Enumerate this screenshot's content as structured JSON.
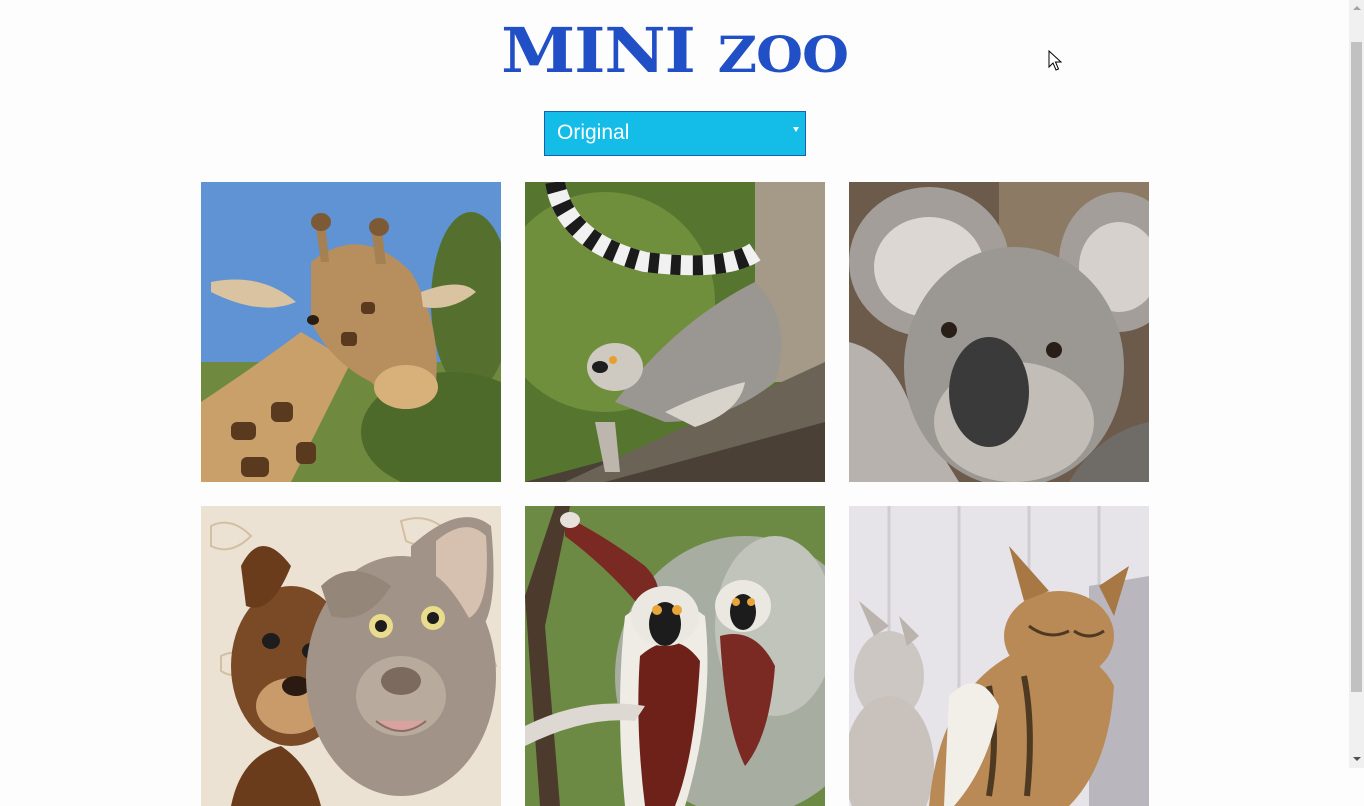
{
  "header": {
    "logo_part1": "MINI",
    "logo_part2": "ZOO"
  },
  "filter": {
    "selected": "Original"
  },
  "gallery": {
    "tiles": [
      {
        "subject": "giraffe"
      },
      {
        "subject": "ring-tailed lemur"
      },
      {
        "subject": "koala"
      },
      {
        "subject": "dogs"
      },
      {
        "subject": "sifaka lemurs"
      },
      {
        "subject": "kittens"
      }
    ]
  },
  "colors": {
    "logo": "#2150c6",
    "select_bg": "#14bde8",
    "select_border": "#1a5fb0"
  }
}
